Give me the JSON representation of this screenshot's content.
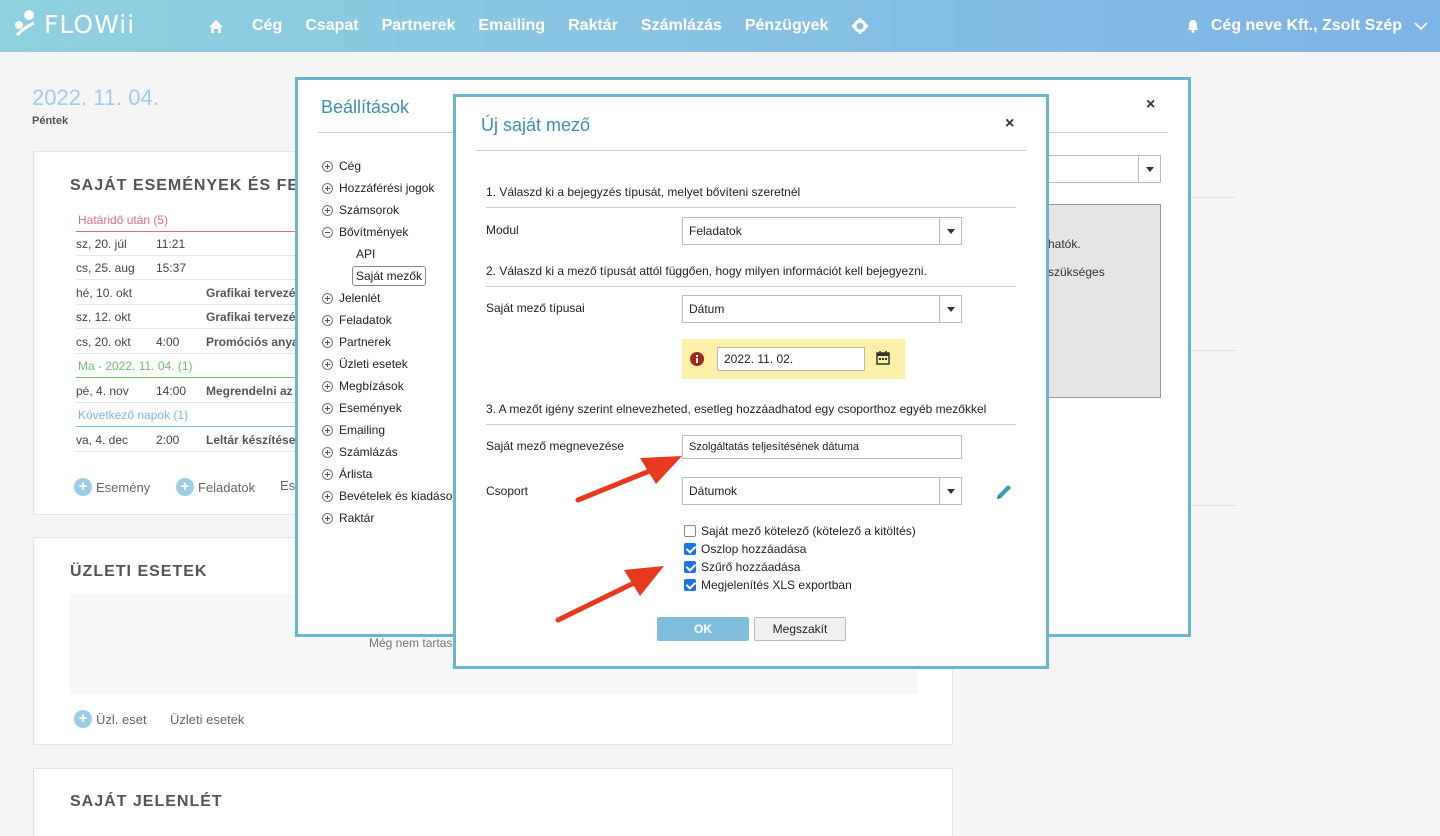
{
  "brand": {
    "logo_text": "FLOWii"
  },
  "nav": {
    "items": [
      "Cég",
      "Csapat",
      "Partnerek",
      "Emailing",
      "Raktár",
      "Számlázás",
      "Pénzügyek"
    ]
  },
  "user": {
    "label": "Cég neve Kft., Zsolt Szép"
  },
  "date": {
    "big": "2022. 11. 04.",
    "day": "Péntek"
  },
  "events": {
    "title": "SAJÁT ESEMÉNYEK ÉS FELA",
    "group_overdue": "Határidő után (5)",
    "group_today": "Ma - 2022. 11. 04. (1)",
    "group_next": "Következő napok (1)",
    "rows_overdue": [
      {
        "date": "sz, 20. júl",
        "time": "11:21",
        "name": ""
      },
      {
        "date": "cs, 25. aug",
        "time": "15:37",
        "name": ""
      },
      {
        "date": "hé, 10. okt",
        "time": "",
        "name": "Grafikai tervezés"
      },
      {
        "date": "sz, 12. okt",
        "time": "",
        "name": "Grafikai tervezés"
      },
      {
        "date": "cs, 20. okt",
        "time": "4:00",
        "name": "Promóciós anyag"
      }
    ],
    "row_today": {
      "date": "pé, 4. nov",
      "time": "14:00",
      "name": "Megrendelni az a"
    },
    "row_next": {
      "date": "va, 4. dec",
      "time": "2:00",
      "name": "Leltár készítése"
    },
    "add_event": "Esemény",
    "add_task": "Feladatok",
    "add_more": "Es"
  },
  "cases": {
    "title": "ÜZLETI ESETEK",
    "empty": "Még nem tartas",
    "add_label": "Üzl. eset",
    "link_label": "Üzleti esetek"
  },
  "attendance": {
    "title": "SAJÁT JELENLÉT"
  },
  "settings": {
    "title": "Beállítások",
    "close": "×",
    "tree": [
      "Cég",
      "Hozzáférési jogok",
      "Számsorok",
      "Bővítmények",
      "Jelenlét",
      "Feladatok",
      "Partnerek",
      "Üzleti esetek",
      "Megbízások",
      "Események",
      "Emailing",
      "Számlázás",
      "Árlista",
      "Bevételek és kiadások",
      "Raktár"
    ],
    "sub_api": "API",
    "sub_custom": "Saját mezők",
    "side_text1": "hatók.",
    "side_text2": "szükséges"
  },
  "modal": {
    "title": "Új saját mező",
    "close": "×",
    "step1": "1. Válaszd ki a bejegyzés típusát, melyet bővíteni szeretnél",
    "module_label": "Modul",
    "module_value": "Feladatok",
    "step2": "2. Válaszd ki a mező típusát attól függően, hogy milyen információt kell bejegyezni.",
    "type_label": "Saját mező típusai",
    "type_value": "Dátum",
    "date_value": "2022. 11. 02.",
    "step3": "3. A mezőt igény szerint elnevezheted, esetleg hozzáadhatod egy csoporthoz egyéb mezőkkel",
    "name_label": "Saját mező megnevezése",
    "name_value": "Szolgáltatás teljesítésének dátuma",
    "group_label": "Csoport",
    "group_value": "Dátumok",
    "checkboxes": [
      {
        "label": "Saját mező kötelező (kötelező a kitöltés)",
        "checked": false
      },
      {
        "label": "Oszlop hozzáadása",
        "checked": true
      },
      {
        "label": "Szűrő hozzáadása",
        "checked": true
      },
      {
        "label": "Megjelenítés XLS exportban",
        "checked": true
      }
    ],
    "ok": "OK",
    "cancel": "Megszakít"
  },
  "colors": {
    "accent": "#6bb6ce",
    "ok_button": "#7fbfdb",
    "arrow": "#e8381e",
    "overdue": "#e06c7b",
    "today": "#6abf69",
    "next": "#7cb5e6"
  }
}
